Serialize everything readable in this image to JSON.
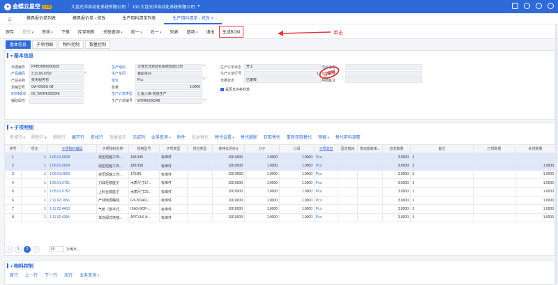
{
  "topbar": {
    "brand": "金蝶云星空",
    "badge": "企业版",
    "org1": "大连光洋自动化系统有限公司",
    "org2": "100 大连光洋自动化系统有限公司"
  },
  "tabs": [
    "模具报价单列表",
    "模具报价单 - 修改",
    "生产用料清单列表",
    "生产用料清单 - 修改"
  ],
  "toolbar": {
    "items": [
      {
        "label": "保存",
        "state": "normal"
      },
      {
        "label": "提交",
        "state": "dis-dd"
      },
      {
        "label": "审核",
        "state": "dd"
      },
      {
        "label": "下推",
        "state": "normal"
      },
      {
        "label": "库存刷新",
        "state": "normal"
      },
      {
        "label": "关联查询",
        "state": "dd"
      },
      {
        "label": "前一",
        "state": "dd"
      },
      {
        "label": "后一",
        "state": "dd"
      },
      {
        "label": "列表",
        "state": "normal"
      },
      {
        "label": "选项",
        "state": "dd"
      },
      {
        "label": "退出",
        "state": "normal"
      }
    ],
    "highlight": "生成BOM",
    "annotation": "单击"
  },
  "subtabs": [
    "基本信息",
    "子项明细",
    "物料控制",
    "数量控制"
  ],
  "basic": {
    "title": "基本信息",
    "col1": [
      {
        "label": "单据编号",
        "value": "PPBOM00000626"
      },
      {
        "label": "产品编码",
        "value": "3.11.06.0752",
        "link": true,
        "req": true
      },
      {
        "label": "产品名称",
        "value": "技术服务包"
      },
      {
        "label": "规格型号",
        "value": "GA-K600U-08"
      },
      {
        "label": "BOM版本",
        "value": "00_WORK020249",
        "link": true
      },
      {
        "label": "辅助属性",
        "value": ""
      }
    ],
    "col2": [
      {
        "label": "生产组织",
        "value": "大连光洋自动化系统有限公司",
        "link": true,
        "req": true
      },
      {
        "label": "生产车间",
        "value": "装配车间",
        "link": true
      },
      {
        "label": "单位",
        "value": "Pcs",
        "link": true,
        "req": true
      },
      {
        "label": "数量",
        "value": "3.0000"
      },
      {
        "label": "生产订单类型",
        "value": "汇报入库-普通生产",
        "link": true
      },
      {
        "label": "生产订单编号",
        "value": "WORK020249",
        "req": true
      }
    ],
    "col3": [
      {
        "label": "生产订单状态",
        "value": "开工"
      },
      {
        "label": "生产订单行号",
        "value": "1"
      },
      {
        "label": "单据状态",
        "value": "已审核"
      }
    ],
    "checkbox": "是否允许补料单",
    "col4": [
      {
        "label": "项目名称",
        "value": "",
        "link": true
      },
      {
        "label": "计划属性",
        "value": ""
      },
      {
        "label": "明细备注",
        "value": ""
      }
    ],
    "stamp": "已审核"
  },
  "detail": {
    "title": "子项明细",
    "tools": [
      {
        "label": "新增行",
        "state": "dis-dd"
      },
      {
        "label": "删除行",
        "state": "dis-dd"
      },
      {
        "label": "删除行",
        "state": "dis"
      },
      {
        "label": "展开行",
        "state": "normal"
      },
      {
        "label": "查找行",
        "state": "normal"
      },
      {
        "label": "批量填充",
        "state": "dis"
      },
      {
        "label": "冻结列",
        "state": "normal"
      },
      {
        "label": "业务查询",
        "state": "dd"
      },
      {
        "label": "附件",
        "state": "normal"
      },
      {
        "label": "批发替代",
        "state": "dis"
      },
      {
        "label": "替代设置",
        "state": "dd"
      },
      {
        "label": "替代删除",
        "state": "normal"
      },
      {
        "label": "获取替代",
        "state": "normal"
      },
      {
        "label": "重新获取替代",
        "state": "normal"
      },
      {
        "label": "预留",
        "state": "dd"
      },
      {
        "label": "替代用料调整",
        "state": "normal"
      }
    ],
    "columns": [
      "序号",
      "项次",
      "子项物料编码",
      "子项物料名称",
      "规格型号",
      "子项类型",
      "供应类型",
      "使用比例(%)",
      "分子",
      "分母",
      "子项单位",
      "固定损耗",
      "变动损耗率...",
      "应发数量",
      "备注",
      "已领数量",
      "未领数量"
    ],
    "rows": [
      [
        "1",
        "1",
        "1.06.01.0828",
        "液压短轴工作...",
        "190/105",
        "标准件",
        "",
        "100.0000",
        "1.0000",
        "1.0000",
        "Pcs",
        "",
        "",
        "3.0000",
        "1",
        "",
        ""
      ],
      [
        "2",
        "1",
        "1.06.01.0824",
        "液压短轴工作...",
        "180/108",
        "标准件",
        "",
        "100.0000",
        "1.0000",
        "1.0000",
        "Pcs",
        "",
        "",
        "3.0000",
        "1",
        "",
        "1.0000"
      ],
      [
        "3",
        "1",
        "1.06.01.0820",
        "液压短轴工作...",
        "175/96",
        "标准件",
        "",
        "100.0000",
        "1.0000",
        "1.0000",
        "Pcs",
        "",
        "",
        "3.0000",
        "1",
        "",
        "1.0000"
      ],
      [
        "4",
        "1",
        "1.05.01.0751",
        "刀具柜底座子",
        "木质尺寸17...",
        "标准件",
        "",
        "100.0000",
        "1.0000",
        "1.0000",
        "Pcs",
        "",
        "",
        "3.0000",
        "1",
        "",
        "1.0000"
      ],
      [
        "5",
        "1",
        "1.05.01.0752",
        "上料台底座子",
        "木质尺寸20...",
        "标准件",
        "",
        "100.0000",
        "1.0000",
        "1.0000",
        "Pcs",
        "",
        "",
        "3.0000",
        "1",
        "",
        "1.0000"
      ],
      [
        "6",
        "1",
        "2.11.02.1656",
        "产线电源确线...",
        "GY-202411...",
        "标准件",
        "",
        "100.0000",
        "1.0000",
        "1.0000",
        "Pcs",
        "",
        "",
        "3.0000",
        "1",
        "",
        "1.0000"
      ],
      [
        "7",
        "1",
        "1.11.02.4403",
        "气枪（数字式...",
        "ISA3-GCP-...",
        "标准件",
        "",
        "100.0000",
        "1.0000",
        "1.0000",
        "Pcs",
        "",
        "",
        "3.0000",
        "1",
        "",
        "1.0000"
      ],
      [
        "8",
        "1",
        "1.11.02.4394",
        "单向阀式快插...",
        "APCVU6 A...",
        "标准件",
        "",
        "100.0000",
        "1.0000",
        "1.0000",
        "Pcs",
        "",
        "",
        "3.0000",
        "1",
        "",
        "1.0000"
      ]
    ],
    "pager": {
      "pages": [
        "1",
        "2"
      ],
      "current": "2",
      "page_size": "50",
      "page_size_label": "行每页"
    }
  },
  "material": {
    "title": "物料控制",
    "tools": [
      {
        "label": "首行",
        "state": "normal"
      },
      {
        "label": "上一行",
        "state": "normal"
      },
      {
        "label": "下一行",
        "state": "normal"
      },
      {
        "label": "末行",
        "state": "normal"
      },
      {
        "label": "业务查询",
        "state": "dd"
      }
    ]
  }
}
